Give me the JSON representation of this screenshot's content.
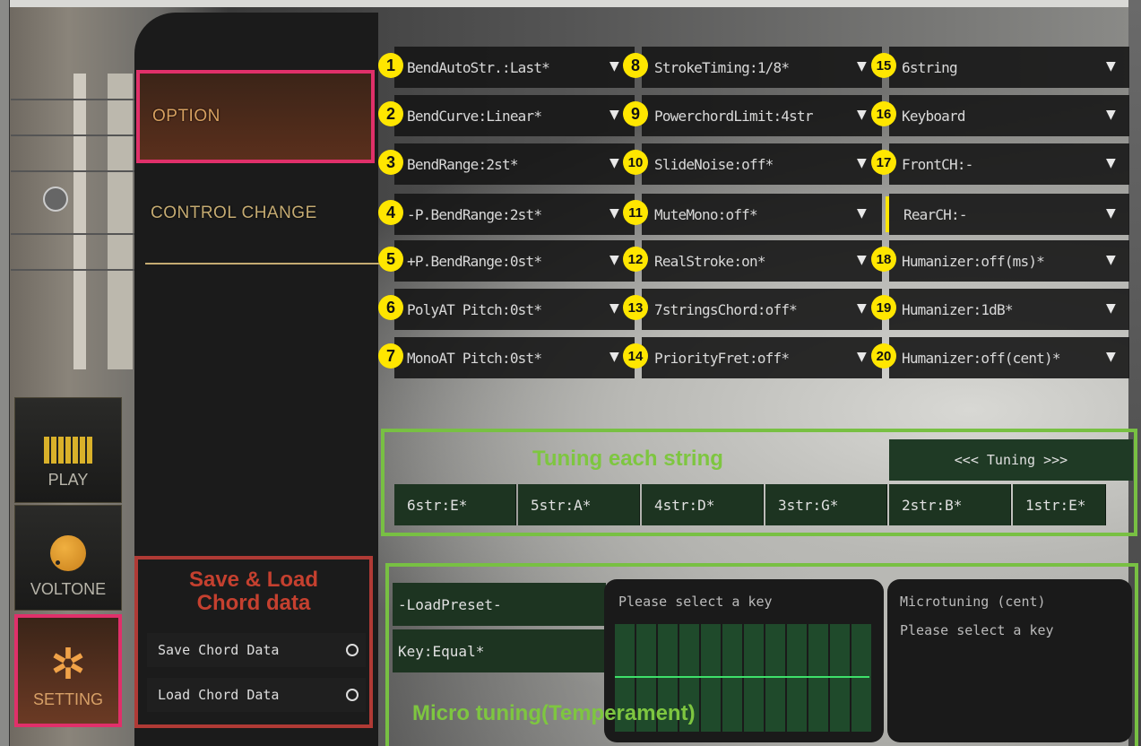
{
  "nav": {
    "option": "OPTION",
    "control_change": "CONTROL CHANGE"
  },
  "left_buttons": {
    "play": "PLAY",
    "voltone": "VOLTONE",
    "setting": "SETTING"
  },
  "params": [
    {
      "n": "1",
      "label": "BendAutoStr.:Last*"
    },
    {
      "n": "2",
      "label": "BendCurve:Linear*"
    },
    {
      "n": "3",
      "label": "BendRange:2st*"
    },
    {
      "n": "4",
      "label": "-P.BendRange:2st*"
    },
    {
      "n": "5",
      "label": "+P.BendRange:0st*"
    },
    {
      "n": "6",
      "label": "PolyAT Pitch:0st*"
    },
    {
      "n": "7",
      "label": "MonoAT Pitch:0st*"
    },
    {
      "n": "8",
      "label": "StrokeTiming:1/8*"
    },
    {
      "n": "9",
      "label": "PowerchordLimit:4str"
    },
    {
      "n": "10",
      "label": "SlideNoise:off*"
    },
    {
      "n": "11",
      "label": "MuteMono:off*"
    },
    {
      "n": "12",
      "label": "RealStroke:on*"
    },
    {
      "n": "13",
      "label": "7stringsChord:off*"
    },
    {
      "n": "14",
      "label": "PriorityFret:off*"
    },
    {
      "n": "15",
      "label": "6string"
    },
    {
      "n": "16",
      "label": "Keyboard"
    },
    {
      "n": "17",
      "label": "FrontCH:-"
    },
    {
      "n": "",
      "label": "RearCH:-"
    },
    {
      "n": "18",
      "label": "Humanizer:off(ms)*"
    },
    {
      "n": "19",
      "label": "Humanizer:1dB*"
    },
    {
      "n": "20",
      "label": "Humanizer:off(cent)*"
    }
  ],
  "tuning": {
    "title": "Tuning each string",
    "button": "<<< Tuning >>>",
    "strings": [
      "6str:E*",
      "5str:A*",
      "4str:D*",
      "3str:G*",
      "2str:B*",
      "1str:E*"
    ]
  },
  "micro": {
    "load_preset": "-LoadPreset-",
    "key": "Key:Equal*",
    "key_prompt": "Please select a key",
    "cent_title": "Microtuning (cent)",
    "cent_prompt": "Please select a key",
    "label": "Micro tuning(Temperament)"
  },
  "save_load": {
    "title_line1": "Save & Load",
    "title_line2": "Chord data",
    "save": "Save Chord Data",
    "load": "Load Chord Data"
  },
  "colors": {
    "highlight_pink": "#e0306a",
    "tuning_green": "#78c043",
    "save_red": "#b03a35",
    "badge_yellow": "#ffe600"
  }
}
